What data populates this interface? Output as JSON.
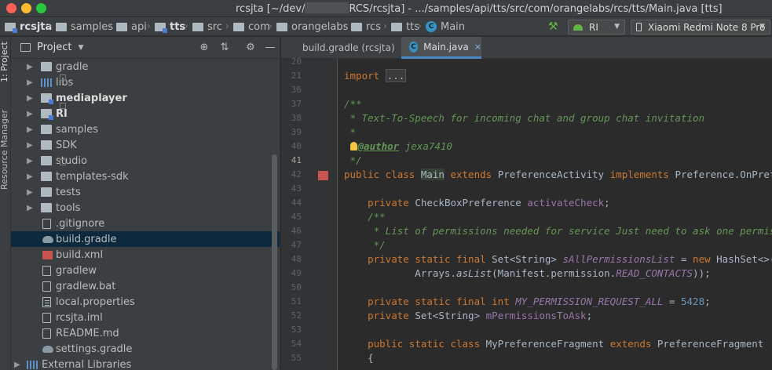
{
  "window": {
    "title_prefix": "rcsjta [~/dev/",
    "title_suffix": "RCS/rcsjta] - .../samples/api/tts/src/com/orangelabs/rcs/tts/Main.java [tts]"
  },
  "breadcrumbs": [
    {
      "label": "rcsjta",
      "bold": true
    },
    {
      "label": "samples"
    },
    {
      "label": "api"
    },
    {
      "label": "tts",
      "bold": true
    },
    {
      "label": "src"
    },
    {
      "label": "com"
    },
    {
      "label": "orangelabs"
    },
    {
      "label": "rcs"
    },
    {
      "label": "tts"
    },
    {
      "label": "Main"
    }
  ],
  "toolbar": {
    "run_config": "RI",
    "device": "Xiaomi Redmi Note 8 Pro"
  },
  "stripe": {
    "project_tab": "1: Project",
    "resource_tab": "Resource Manager"
  },
  "project_panel": {
    "title": "Project",
    "items": [
      {
        "label": "gradle",
        "type": "folder",
        "arrow": true
      },
      {
        "label": "libs",
        "type": "libs",
        "arrow": true
      },
      {
        "label": "mediaplayer",
        "type": "module",
        "arrow": true,
        "bold": true
      },
      {
        "label": "RI",
        "type": "module",
        "arrow": true,
        "bold": true
      },
      {
        "label": "samples",
        "type": "folder",
        "arrow": true
      },
      {
        "label": "SDK",
        "type": "folder",
        "arrow": true
      },
      {
        "label": "studio",
        "type": "folder",
        "arrow": true
      },
      {
        "label": "templates-sdk",
        "type": "folder",
        "arrow": true
      },
      {
        "label": "tests",
        "type": "folder",
        "arrow": true
      },
      {
        "label": "tools",
        "type": "folder",
        "arrow": true
      },
      {
        "label": ".gitignore",
        "type": "file"
      },
      {
        "label": "build.gradle",
        "type": "gradle",
        "selected": true
      },
      {
        "label": "build.xml",
        "type": "xml"
      },
      {
        "label": "gradlew",
        "type": "file"
      },
      {
        "label": "gradlew.bat",
        "type": "file"
      },
      {
        "label": "local.properties",
        "type": "props"
      },
      {
        "label": "rcsjta.iml",
        "type": "file"
      },
      {
        "label": "README.md",
        "type": "file"
      },
      {
        "label": "settings.gradle",
        "type": "gradle"
      },
      {
        "label": "External Libraries",
        "type": "libs",
        "arrow": true,
        "root": true
      }
    ]
  },
  "editor": {
    "tabs": [
      {
        "label": "build.gradle (rcsjta)",
        "active": false
      },
      {
        "label": "Main.java",
        "active": true
      }
    ],
    "current_line": "41",
    "lines": [
      {
        "n": "20",
        "html": ""
      },
      {
        "n": "21",
        "html": "<span class=\"k\">import</span> <span class=\"fold\">...</span>"
      },
      {
        "n": "36",
        "html": ""
      },
      {
        "n": "37",
        "html": "<span class=\"c\">/**</span>"
      },
      {
        "n": "38",
        "html": "<span class=\"c\"> * Text-To-Speech for incoming chat and group chat invitation</span>"
      },
      {
        "n": "39",
        "html": "<span class=\"c\"> *</span>"
      },
      {
        "n": "40",
        "html": "<span class=\"c\"> </span><span class=\"bulb\"></span><span class=\"t\">@author</span><span class=\"c\"> jexa7410</span>"
      },
      {
        "n": "41",
        "html": "<span class=\"c\"> */</span>"
      },
      {
        "n": "42",
        "html": "<span class=\"k\">public class </span><span class=\"hl\">Main</span> <span class=\"k\">extends</span> PreferenceActivity <span class=\"k\">implements</span> Preference.OnPreferenc"
      },
      {
        "n": "43",
        "html": ""
      },
      {
        "n": "44",
        "html": "    <span class=\"k\">private</span> CheckBoxPreference <span class=\"f\">activateCheck</span>;"
      },
      {
        "n": "45",
        "html": "    <span class=\"c\">/**</span>"
      },
      {
        "n": "46",
        "html": "<span class=\"c\">     * List of permissions needed for service Just need to ask one permission</span>"
      },
      {
        "n": "47",
        "html": "<span class=\"c\">     */</span>"
      },
      {
        "n": "48",
        "html": "    <span class=\"k\">private static final</span> Set&lt;String&gt; <span class=\"fi\">sAllPermissionsList</span> = <span class=\"k\">new</span> HashSet&lt;&gt;("
      },
      {
        "n": "49",
        "html": "            Arrays.<span class=\"mi\">asList</span>(Manifest.permission.<span class=\"fi\">READ_CONTACTS</span>));"
      },
      {
        "n": "50",
        "html": ""
      },
      {
        "n": "51",
        "html": "    <span class=\"k\">private static final int</span> <span class=\"fi\">MY_PERMISSION_REQUEST_ALL</span> = <span class=\"n\">5428</span>;"
      },
      {
        "n": "52",
        "html": "    <span class=\"k\">private</span> Set&lt;String&gt; <span class=\"f\">mPermissionsToAsk</span>;"
      },
      {
        "n": "53",
        "html": ""
      },
      {
        "n": "54",
        "html": "    <span class=\"k\">public static class</span> MyPreferenceFragment <span class=\"k\">extends</span> PreferenceFragment"
      },
      {
        "n": "55",
        "html": "    {"
      }
    ]
  }
}
